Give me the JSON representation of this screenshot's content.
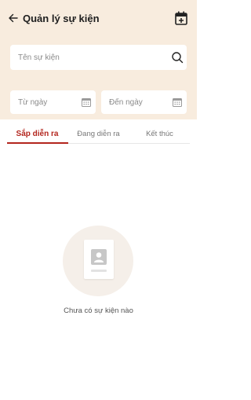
{
  "header": {
    "title": "Quản lý sự kiện",
    "back_icon": "arrow-left-icon",
    "add_event_icon": "calendar-plus-icon"
  },
  "search": {
    "placeholder": "Tên sự kiện",
    "value": "",
    "icon": "search-icon"
  },
  "date_filter": {
    "from_placeholder": "Từ ngày",
    "to_placeholder": "Đến ngày",
    "icon": "calendar-icon"
  },
  "tabs": [
    {
      "label": "Sắp diễn ra",
      "active": true
    },
    {
      "label": "Đang diễn ra",
      "active": false
    },
    {
      "label": "Kết thúc",
      "active": false
    }
  ],
  "empty_state": {
    "message": "Chưa có sự kiện nào",
    "icon": "empty-profile-card-icon"
  },
  "colors": {
    "header_bg": "#f8ecde",
    "accent": "#b3261e",
    "empty_circle": "#f5efe9"
  }
}
